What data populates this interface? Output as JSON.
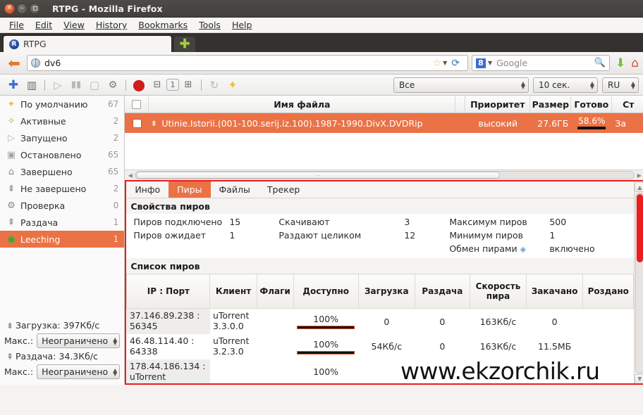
{
  "window": {
    "title": "RTPG - Mozilla Firefox",
    "buttons": [
      "close",
      "minimize",
      "maximize"
    ]
  },
  "menubar": {
    "items": [
      "File",
      "Edit",
      "View",
      "History",
      "Bookmarks",
      "Tools",
      "Help"
    ]
  },
  "tabs": {
    "open": [
      {
        "label": "RTPG",
        "favicon": "R"
      }
    ],
    "new_tab_label": "+"
  },
  "navbar": {
    "back_icon": "back-arrow-icon",
    "url_value": "dv6",
    "bookmark_icon": "star-icon",
    "reload_icon": "reload-icon",
    "search_engine": "8",
    "search_placeholder": "Google",
    "search_icon": "magnifier-icon",
    "downloads_icon": "download-arrow-icon",
    "home_icon": "home-icon"
  },
  "apptoolbar": {
    "buttons": [
      {
        "name": "add-torrent",
        "glyph": "✚",
        "color": "#3a6fd0"
      },
      {
        "name": "remove-torrent",
        "glyph": "🗑",
        "color": "#6a6a6a"
      },
      {
        "name": "start",
        "glyph": "▷",
        "color": "#b0aca8"
      },
      {
        "name": "pause",
        "glyph": "▮▮",
        "color": "#b0aca8"
      },
      {
        "name": "stop",
        "glyph": "▢",
        "color": "#b0aca8"
      },
      {
        "name": "settings",
        "glyph": "⚙",
        "color": "#7a7a7a"
      },
      {
        "name": "force-stop",
        "glyph": "⬤",
        "color": "#d01c1c"
      },
      {
        "name": "priority-down",
        "glyph": "⊟",
        "color": "#6a6a6a"
      },
      {
        "name": "priority-one",
        "glyph": "1",
        "color": "#6a6a6a"
      },
      {
        "name": "priority-up",
        "glyph": "⊞",
        "color": "#6a6a6a"
      },
      {
        "name": "refresh",
        "glyph": "↻",
        "color": "#b0aca8"
      },
      {
        "name": "star-default",
        "glyph": "✦",
        "color": "#e6c23d"
      }
    ],
    "filter_select": "Все",
    "interval_select": "10 сек.",
    "lang_select": "RU"
  },
  "sidebar": {
    "items": [
      {
        "label": "По умолчанию",
        "count": "67",
        "icon": "star-icon",
        "glyph": "✦",
        "color": "#e6c23d",
        "active": false
      },
      {
        "label": "Активные",
        "count": "2",
        "icon": "active-star-icon",
        "glyph": "✧",
        "color": "#8fbf34",
        "active": false
      },
      {
        "label": "Запущено",
        "count": "2",
        "icon": "play-icon",
        "glyph": "▷",
        "color": "#b0aca8",
        "active": false
      },
      {
        "label": "Остановлено",
        "count": "65",
        "icon": "stop-icon",
        "glyph": "▢",
        "color": "#9a9894",
        "active": false
      },
      {
        "label": "Завершено",
        "count": "65",
        "icon": "home-icon",
        "glyph": "⌂",
        "color": "#8b8884",
        "active": false
      },
      {
        "label": "Не завершено",
        "count": "2",
        "icon": "download-icon",
        "glyph": "⇟",
        "color": "#8b8884",
        "active": false
      },
      {
        "label": "Проверка",
        "count": "0",
        "icon": "gears-icon",
        "glyph": "⚙",
        "color": "#8b8884",
        "active": false
      },
      {
        "label": "Раздача",
        "count": "1",
        "icon": "upload-icon",
        "glyph": "⇞",
        "color": "#8b8884",
        "active": false
      },
      {
        "label": "Leeching",
        "count": "1",
        "icon": "leech-icon",
        "glyph": "◉",
        "color": "#2fa83c",
        "active": true
      }
    ],
    "download_icon": "download-icon",
    "download_label": "Загрузка: 397Кб/c",
    "download_max_label": "Макс.:",
    "download_max_value": "Неограничено",
    "upload_icon": "upload-icon",
    "upload_label": "Раздача: 34.3Кб/с",
    "upload_max_label": "Макс.:",
    "upload_max_value": "Неограничено"
  },
  "torrent_list": {
    "headers": {
      "checkbox": "",
      "name": "Имя файла",
      "priority": "Приоритет",
      "size": "Размер",
      "done": "Готово",
      "status": "Ст"
    },
    "rows": [
      {
        "name": "Utinie.Istorii.(001-100.serij.iz.100).1987-1990.DivX.DVDRip",
        "priority": "высокий",
        "size": "27.6ГБ",
        "done": "58.6%",
        "done_pct": 58.6,
        "status": "За",
        "icon": "download-icon",
        "selected": true
      }
    ],
    "hscroll_thumb_pct": 73
  },
  "detail": {
    "tabs": [
      {
        "label": "Инфо",
        "active": false
      },
      {
        "label": "Пиры",
        "active": true
      },
      {
        "label": "Файлы",
        "active": false
      },
      {
        "label": "Трекер",
        "active": false
      }
    ],
    "peer_props_title": "Свойства пиров",
    "peer_props": {
      "col1": [
        {
          "key": "Пиров подключено",
          "value": "15"
        },
        {
          "key": "Пиров ожидает",
          "value": "1"
        }
      ],
      "col2": [
        {
          "key": "Скачивают",
          "value": "3"
        },
        {
          "key": "Раздают целиком",
          "value": "12"
        }
      ],
      "col3": [
        {
          "key": "Максимум пиров",
          "value": "500",
          "icon": ""
        },
        {
          "key": "Минимум пиров",
          "value": "1",
          "icon": ""
        },
        {
          "key": "Обмен пирами",
          "value": "включено",
          "icon": "diamond-icon"
        }
      ]
    },
    "peer_list_title": "Список пиров",
    "peer_table": {
      "headers": [
        "IP : Порт",
        "Клиент",
        "Флаги",
        "Доступно",
        "Загрузка",
        "Раздача",
        "Скорость пира",
        "Закачано",
        "Роздано"
      ],
      "rows": [
        {
          "ip": "37.146.89.238 : 56345",
          "client": "uTorrent 3.3.0.0",
          "flags": "",
          "available": "100%",
          "download": "0",
          "upload": "0",
          "peer_speed": "163Кб/с",
          "downloaded": "0",
          "uploaded": ""
        },
        {
          "ip": "46.48.114.40 : 64338",
          "client": "uTorrent 3.2.3.0",
          "flags": "",
          "available": "100%",
          "download": "54Кб/с",
          "upload": "0",
          "peer_speed": "163Кб/с",
          "downloaded": "11.5МБ",
          "uploaded": ""
        },
        {
          "ip": "178.44.186.134 : uTorrent",
          "client": "",
          "flags": "",
          "available": "100%",
          "download": "",
          "upload": "",
          "peer_speed": "",
          "downloaded": "",
          "uploaded": ""
        }
      ]
    },
    "vscroll_thumb_pct": 38,
    "hscroll_thumb_pct": 93,
    "border_color": "#ee1c1c",
    "scroll_color": "#ee1c1c"
  },
  "watermark": "www.ekzorchik.ru",
  "colors": {
    "accent": "#eb7245",
    "titlebar": "#423f3c",
    "highlight_red": "#ee1c1c"
  }
}
